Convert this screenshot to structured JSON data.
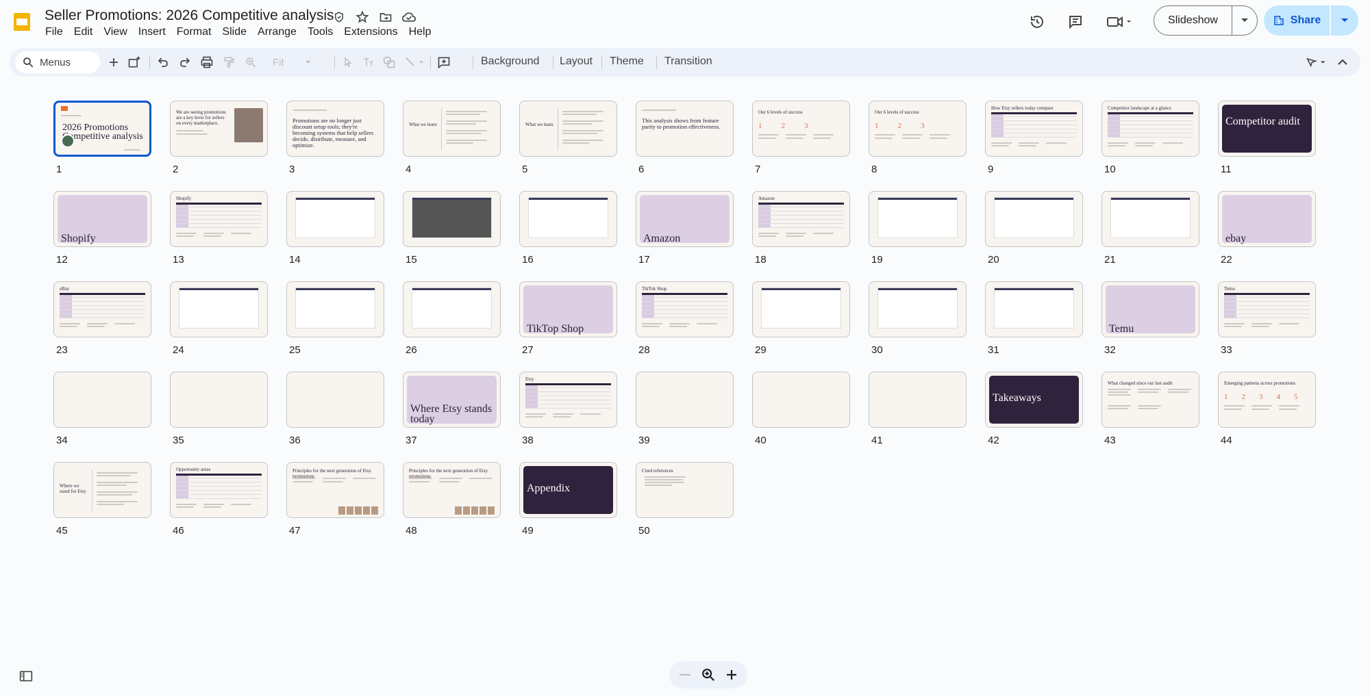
{
  "doc": {
    "title": "Seller Promotions: 2026 Competitive analysis",
    "app_logo_color": "#f4b400"
  },
  "menu": [
    "File",
    "Edit",
    "View",
    "Insert",
    "Format",
    "Slide",
    "Arrange",
    "Tools",
    "Extensions",
    "Help"
  ],
  "header": {
    "slideshow_label": "Slideshow",
    "share_label": "Share",
    "accent": "#0b57d0",
    "share_bg": "#c2e7ff"
  },
  "toolbar": {
    "search_label": "Menus",
    "zoom_label": "Fit",
    "background_label": "Background",
    "layout_label": "Layout",
    "theme_label": "Theme",
    "transition_label": "Transition"
  },
  "slides": [
    {
      "n": "1",
      "kind": "cover",
      "text": "2026 Promotions Competitive analysis",
      "selected": true
    },
    {
      "n": "2",
      "kind": "photo",
      "text": "We are seeing promotions are a key lever for sellers on every marketplace."
    },
    {
      "n": "3",
      "kind": "statement",
      "text": "Promotions are no longer just discount setup tools; they're becoming systems that help sellers decide, distribute, measure, and optimize."
    },
    {
      "n": "4",
      "kind": "list",
      "text": "What we learn"
    },
    {
      "n": "5",
      "kind": "list",
      "text": "What we learn"
    },
    {
      "n": "6",
      "kind": "statement",
      "text": "This analysis shows from feature parity to promotion effectiveness."
    },
    {
      "n": "7",
      "kind": "numbers3",
      "text": "Our 6 levels of success"
    },
    {
      "n": "8",
      "kind": "numbers3",
      "text": "Our 6 levels of success"
    },
    {
      "n": "9",
      "kind": "table",
      "text": "How Etsy sellers today compare"
    },
    {
      "n": "10",
      "kind": "table",
      "text": "Competitor landscape at a glance"
    },
    {
      "n": "11",
      "kind": "dark",
      "text": "Competitor audit"
    },
    {
      "n": "12",
      "kind": "purple",
      "text": "Shopify"
    },
    {
      "n": "13",
      "kind": "table",
      "text": "Shopify"
    },
    {
      "n": "14",
      "kind": "screenshot",
      "text": ""
    },
    {
      "n": "15",
      "kind": "screenshot-dark",
      "text": ""
    },
    {
      "n": "16",
      "kind": "screenshot",
      "text": ""
    },
    {
      "n": "17",
      "kind": "purple",
      "text": "Amazon"
    },
    {
      "n": "18",
      "kind": "table",
      "text": "Amazon"
    },
    {
      "n": "19",
      "kind": "screenshot",
      "text": ""
    },
    {
      "n": "20",
      "kind": "screenshot",
      "text": ""
    },
    {
      "n": "21",
      "kind": "screenshot",
      "text": ""
    },
    {
      "n": "22",
      "kind": "purple",
      "text": "ebay"
    },
    {
      "n": "23",
      "kind": "table",
      "text": "eBay"
    },
    {
      "n": "24",
      "kind": "screenshot",
      "text": ""
    },
    {
      "n": "25",
      "kind": "screenshot",
      "text": ""
    },
    {
      "n": "26",
      "kind": "screenshot",
      "text": ""
    },
    {
      "n": "27",
      "kind": "purple",
      "text": "TikTop Shop"
    },
    {
      "n": "28",
      "kind": "table",
      "text": "TikTok Shop"
    },
    {
      "n": "29",
      "kind": "screenshot",
      "text": ""
    },
    {
      "n": "30",
      "kind": "screenshot",
      "text": ""
    },
    {
      "n": "31",
      "kind": "screenshot",
      "text": ""
    },
    {
      "n": "32",
      "kind": "purple",
      "text": "Temu"
    },
    {
      "n": "33",
      "kind": "table",
      "text": "Temu"
    },
    {
      "n": "34",
      "kind": "blank",
      "text": ""
    },
    {
      "n": "35",
      "kind": "blank",
      "text": ""
    },
    {
      "n": "36",
      "kind": "blank",
      "text": ""
    },
    {
      "n": "37",
      "kind": "purple-wrap",
      "text": "Where Etsy stands today"
    },
    {
      "n": "38",
      "kind": "table",
      "text": "Etsy"
    },
    {
      "n": "39",
      "kind": "blank",
      "text": ""
    },
    {
      "n": "40",
      "kind": "blank",
      "text": ""
    },
    {
      "n": "41",
      "kind": "blank",
      "text": ""
    },
    {
      "n": "42",
      "kind": "dark-mid",
      "text": "Takeaways"
    },
    {
      "n": "43",
      "kind": "columns",
      "text": "What changed since our last audit"
    },
    {
      "n": "44",
      "kind": "numbers5",
      "text": "Emerging patterns across promotions"
    },
    {
      "n": "45",
      "kind": "list",
      "text": "Where we stand for Etsy"
    },
    {
      "n": "46",
      "kind": "table",
      "text": "Opportunity areas"
    },
    {
      "n": "47",
      "kind": "images",
      "text": "Principles for the next generation of Etsy promotions"
    },
    {
      "n": "48",
      "kind": "images",
      "text": "Principles for the next generation of Etsy promotions"
    },
    {
      "n": "49",
      "kind": "dark-mid",
      "text": "Appendix"
    },
    {
      "n": "50",
      "kind": "links",
      "text": "Cited references"
    }
  ]
}
